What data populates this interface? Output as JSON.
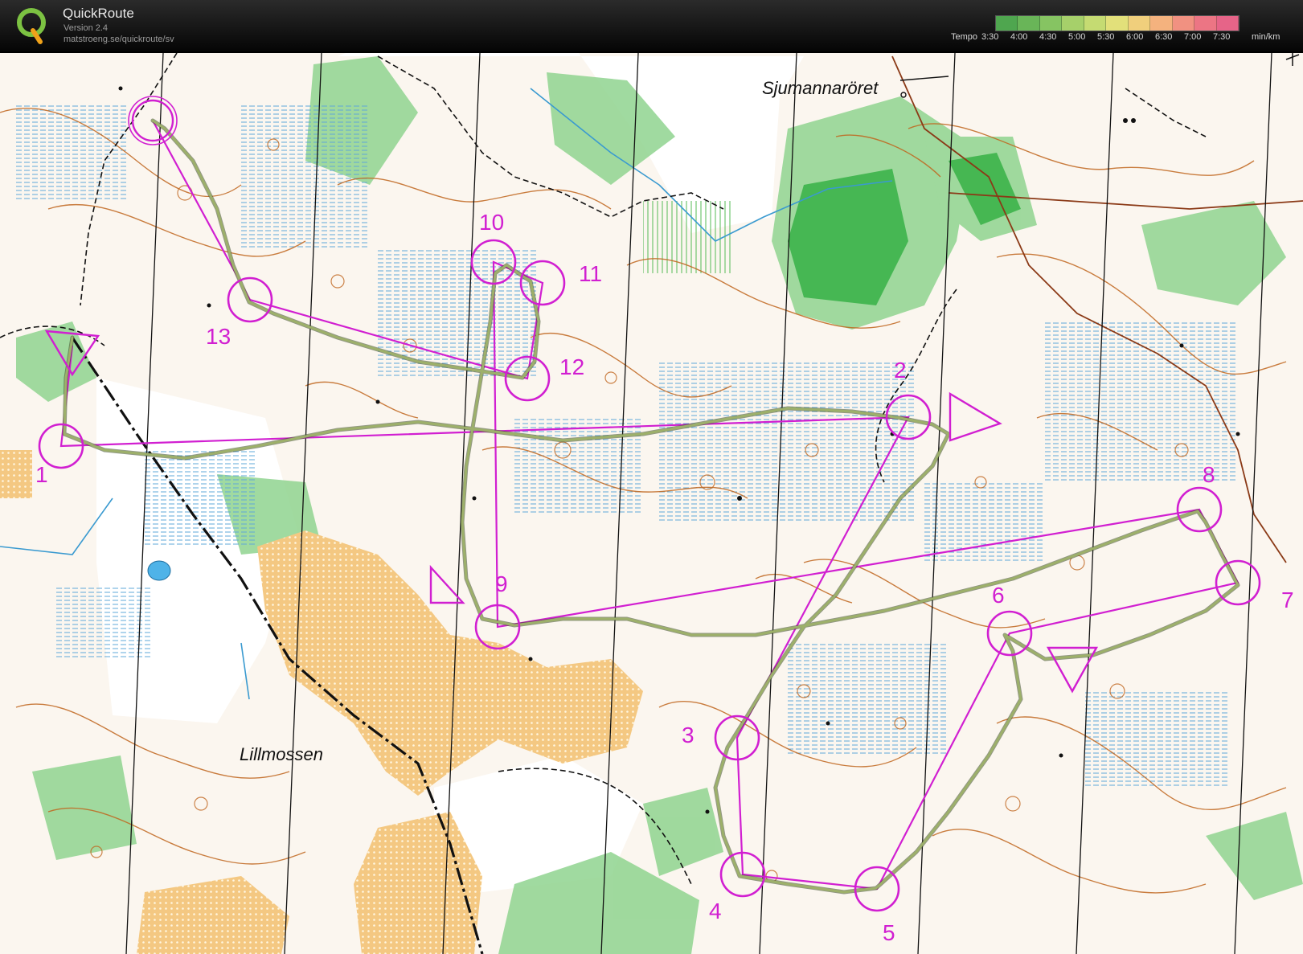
{
  "app": {
    "title": "QuickRoute",
    "version": "Version 2.4",
    "url": "matstroeng.se/quickroute/sv"
  },
  "pace_legend": {
    "caption": "Tempo",
    "ticks": [
      "3:30",
      "4:00",
      "4:30",
      "5:00",
      "5:30",
      "6:00",
      "6:30",
      "7:00",
      "7:30"
    ],
    "unit": "min/km",
    "colors": [
      "#4fa64f",
      "#69b558",
      "#86c462",
      "#a6d06a",
      "#c5db72",
      "#e2e07a",
      "#f0cf7c",
      "#f4b27e",
      "#f19181",
      "#ec7584",
      "#e66488"
    ]
  },
  "map": {
    "place_names": [
      "Sjumannaröret",
      "Lillmossen"
    ],
    "controls": [
      {
        "label": "1"
      },
      {
        "label": "2"
      },
      {
        "label": "3"
      },
      {
        "label": "4"
      },
      {
        "label": "5"
      },
      {
        "label": "6"
      },
      {
        "label": "7"
      },
      {
        "label": "8"
      },
      {
        "label": "9"
      },
      {
        "label": "10"
      },
      {
        "label": "11"
      },
      {
        "label": "12"
      },
      {
        "label": "13"
      }
    ],
    "colors": {
      "course": "#d11fd1",
      "route": "#7a8a55",
      "terrain_base": "#fbf6ef",
      "open_land": "#f3c77f",
      "vegetation": "#8fd48f",
      "marsh": "#8ac5e6",
      "contour": "#c0661f",
      "north_line": "#111111"
    }
  }
}
